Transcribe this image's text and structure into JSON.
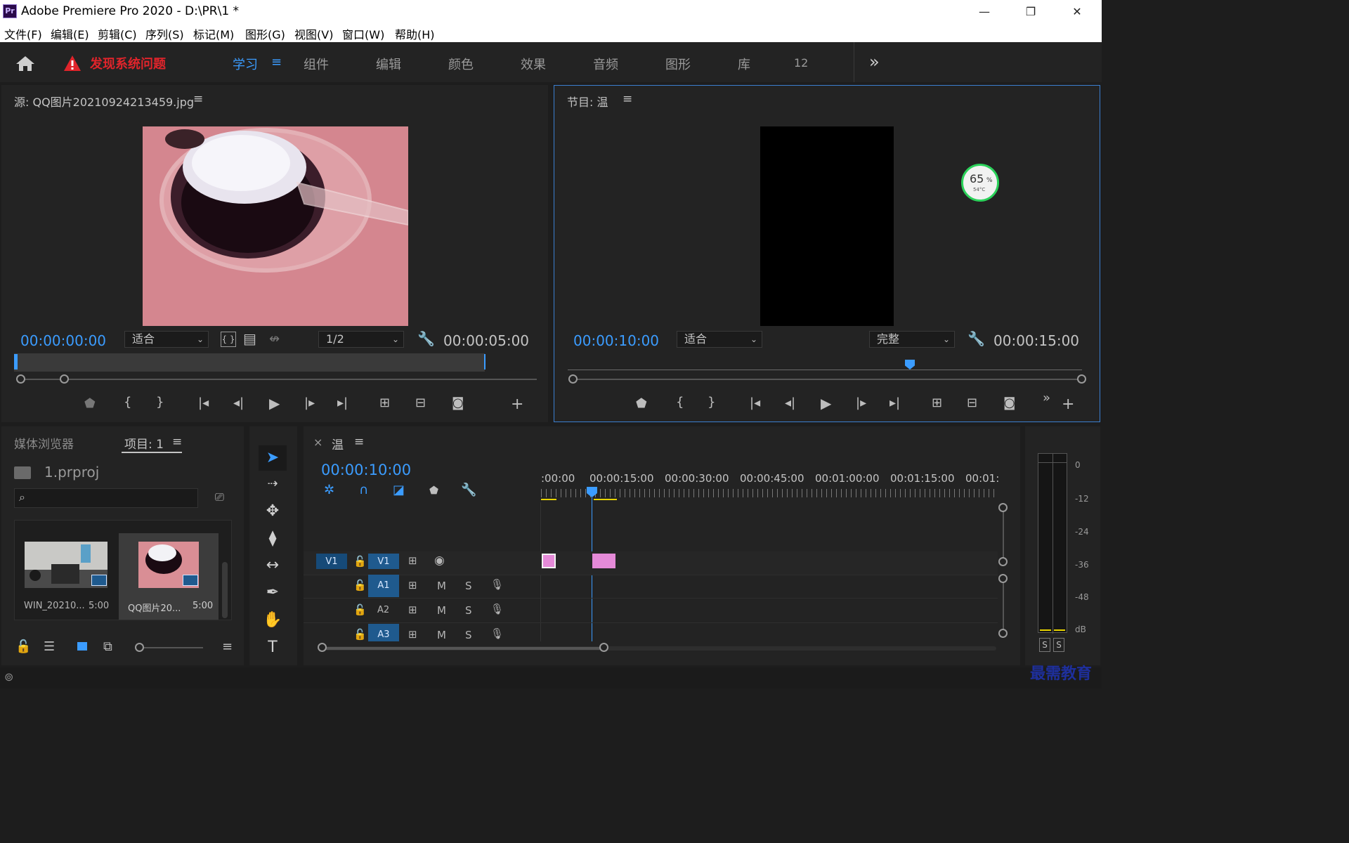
{
  "window": {
    "app_logo": "Pr",
    "title": "Adobe Premiere Pro 2020 - D:\\PR\\1 *",
    "minimize": "—",
    "restore": "❐",
    "close": "✕"
  },
  "menu": [
    "文件(F)",
    "编辑(E)",
    "剪辑(C)",
    "序列(S)",
    "标记(M)",
    "图形(G)",
    "视图(V)",
    "窗口(W)",
    "帮助(H)"
  ],
  "workspace": {
    "alert_text": "发现系统问题",
    "tabs": [
      "学习",
      "组件",
      "编辑",
      "颜色",
      "效果",
      "音频",
      "图形",
      "库",
      "12"
    ],
    "active_tab": "学习",
    "more": "»"
  },
  "source_monitor": {
    "title": "源: QQ图片20210924213459.jpg",
    "timecode_in": "00:00:00:00",
    "zoom": "适合",
    "resolution": "1/2",
    "duration": "00:00:05:00"
  },
  "program_monitor": {
    "title": "节目: 温",
    "timecode": "00:00:10:00",
    "zoom": "适合",
    "quality": "完整",
    "duration": "00:00:15:00",
    "gauge_percent": "65",
    "gauge_unit": "%",
    "gauge_temp": "54°C"
  },
  "project_panel": {
    "tab_media": "媒体浏览器",
    "tab_project": "项目: 1",
    "project_file": "1.prproj",
    "search_placeholder": "",
    "clips": [
      {
        "name": "WIN_20210...",
        "duration": "5:00"
      },
      {
        "name": "QQ图片20...",
        "duration": "5:00"
      }
    ]
  },
  "timeline": {
    "close": "×",
    "sequence": "温",
    "timecode": "00:00:10:00",
    "ruler_labels": [
      ":00:00",
      "00:00:15:00",
      "00:00:30:00",
      "00:00:45:00",
      "00:01:00:00",
      "00:01:15:00",
      "00:01:"
    ],
    "tracks": {
      "video_src": "V1",
      "video": "V1",
      "audio": [
        "A1",
        "A2",
        "A3"
      ],
      "mute": "M",
      "solo": "S"
    }
  },
  "meter": {
    "labels": [
      "0",
      "-12",
      "-24",
      "-36",
      "-48",
      "dB"
    ],
    "solo_buttons": [
      "S",
      "S"
    ]
  },
  "watermark": "最需教育",
  "colors": {
    "accent_blue": "#3b9cff",
    "alert_red": "#e0242b",
    "clip_pink": "#e58ad8",
    "track_blue": "#1f5a8e"
  }
}
